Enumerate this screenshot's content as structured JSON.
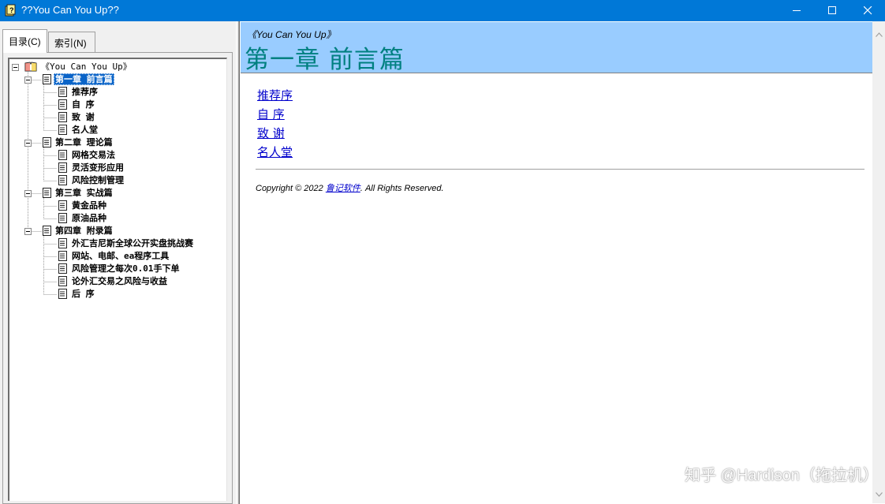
{
  "window": {
    "title": "??You Can You Up??",
    "title_bar_color": "#0078d7"
  },
  "left_pane": {
    "tabs": [
      {
        "label": "目录(C)",
        "active": true
      },
      {
        "label": "索引(N)",
        "active": false
      }
    ],
    "tree": {
      "root": "《You Can You Up》",
      "chapters": [
        {
          "label": "第一章 前言篇",
          "selected": true,
          "items": [
            "推荐序",
            "自 序",
            "致 谢",
            "名人堂"
          ]
        },
        {
          "label": "第二章 理论篇",
          "selected": false,
          "items": [
            "网格交易法",
            "灵活变形应用",
            "风险控制管理"
          ]
        },
        {
          "label": "第三章 实战篇",
          "selected": false,
          "items": [
            "黄金品种",
            "原油品种"
          ]
        },
        {
          "label": "第四章 附录篇",
          "selected": false,
          "items": [
            "外汇吉尼斯全球公开实盘挑战赛",
            "网站、电邮、ea程序工具",
            "风险管理之每次0.01手下单",
            "论外汇交易之风险与收益",
            "后 序"
          ]
        }
      ]
    }
  },
  "content": {
    "banner_subtitle": "《You Can You Up》",
    "banner_title": "第一章 前言篇",
    "banner_color": "#99ccff",
    "title_color": "#008080",
    "links": [
      "推荐序",
      "自 序",
      "致 谢",
      "名人堂"
    ],
    "copyright_prefix": "Copyright © 2022 ",
    "copyright_link": "鲁记软件",
    "copyright_suffix": ". All Rights Reserved."
  },
  "watermark": "知乎 @Hardison（拖拉机）"
}
